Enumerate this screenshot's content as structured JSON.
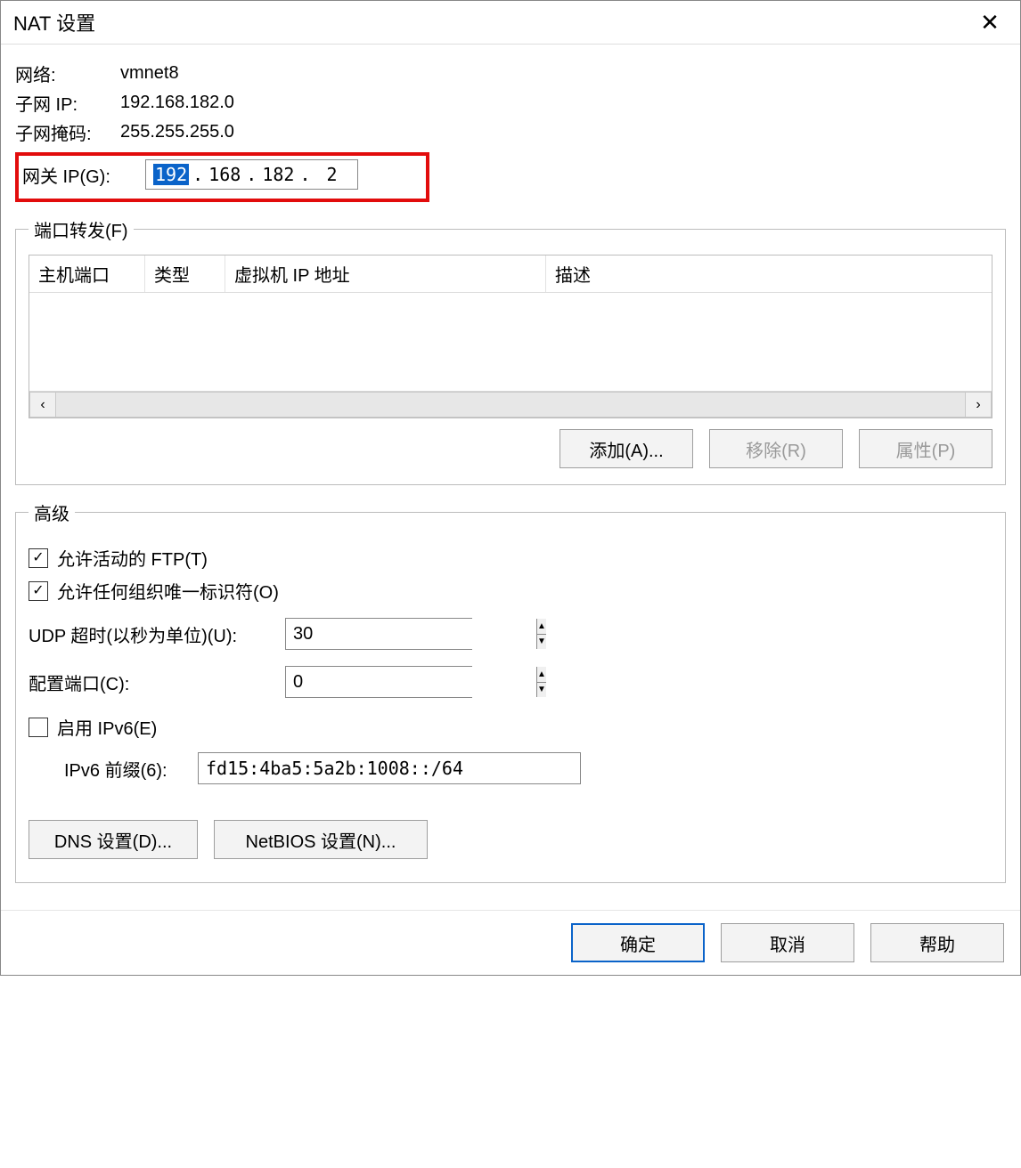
{
  "dialog": {
    "title": "NAT 设置"
  },
  "network": {
    "network_label": "网络:",
    "network_value": "vmnet8",
    "subnet_ip_label": "子网 IP:",
    "subnet_ip_value": "192.168.182.0",
    "subnet_mask_label": "子网掩码:",
    "subnet_mask_value": "255.255.255.0",
    "gateway_label": "网关 IP(G):",
    "gateway_octets": {
      "o1": "192",
      "o2": "168",
      "o3": "182",
      "o4": "2"
    }
  },
  "port_forwarding": {
    "legend": "端口转发(F)",
    "columns": {
      "host_port": "主机端口",
      "type": "类型",
      "vm_ip": "虚拟机 IP 地址",
      "description": "描述"
    },
    "rows": [],
    "buttons": {
      "add": "添加(A)...",
      "remove": "移除(R)",
      "properties": "属性(P)"
    }
  },
  "advanced": {
    "legend": "高级",
    "allow_ftp_label": "允许活动的 FTP(T)",
    "allow_ftp_checked": true,
    "allow_oui_label": "允许任何组织唯一标识符(O)",
    "allow_oui_checked": true,
    "udp_timeout_label": "UDP 超时(以秒为单位)(U):",
    "udp_timeout_value": "30",
    "config_port_label": "配置端口(C):",
    "config_port_value": "0",
    "enable_ipv6_label": "启用 IPv6(E)",
    "enable_ipv6_checked": false,
    "ipv6_prefix_label": "IPv6 前缀(6):",
    "ipv6_prefix_value": "fd15:4ba5:5a2b:1008::/64",
    "buttons": {
      "dns": "DNS 设置(D)...",
      "netbios": "NetBIOS 设置(N)..."
    }
  },
  "footer": {
    "ok": "确定",
    "cancel": "取消",
    "help": "帮助"
  }
}
